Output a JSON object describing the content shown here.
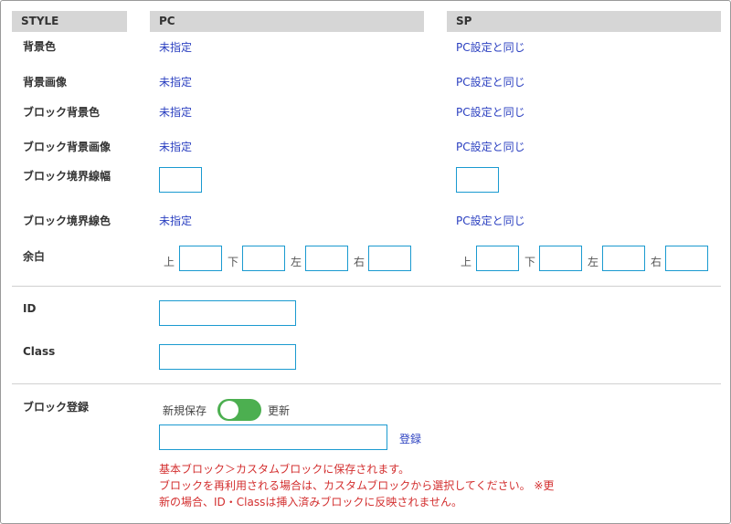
{
  "headers": {
    "style": "STYLE",
    "pc": "PC",
    "sp": "SP"
  },
  "rows": {
    "bg_color": {
      "label": "背景色",
      "pc": "未指定",
      "sp": "PC設定と同じ"
    },
    "bg_image": {
      "label": "背景画像",
      "pc": "未指定",
      "sp": "PC設定と同じ"
    },
    "block_bg_color": {
      "label": "ブロック背景色",
      "pc": "未指定",
      "sp": "PC設定と同じ"
    },
    "block_bg_image": {
      "label": "ブロック背景画像",
      "pc": "未指定",
      "sp": "PC設定と同じ"
    },
    "border_width": {
      "label": "ブロック境界線幅"
    },
    "border_color": {
      "label": "ブロック境界線色",
      "pc": "未指定",
      "sp": "PC設定と同じ"
    },
    "margin": {
      "label": "余白",
      "top": "上",
      "bottom": "下",
      "left": "左",
      "right": "右"
    }
  },
  "id_field": {
    "label": "ID"
  },
  "class_field": {
    "label": "Class"
  },
  "register": {
    "label": "ブロック登録",
    "new_save": "新規保存",
    "update": "更新",
    "button": "登録",
    "toggle_on": false,
    "notes": [
      "基本ブロック＞カスタムブロックに保存されます。",
      "ブロックを再利用される場合は、カスタムブロックから選択してください。 ※更",
      "新の場合、ID・Classは挿入済みブロックに反映されません。"
    ]
  },
  "colors": {
    "link": "#2a3fc0",
    "accent": "#1a9ad0",
    "toggle": "#4caf50",
    "note": "#d32f2f"
  }
}
